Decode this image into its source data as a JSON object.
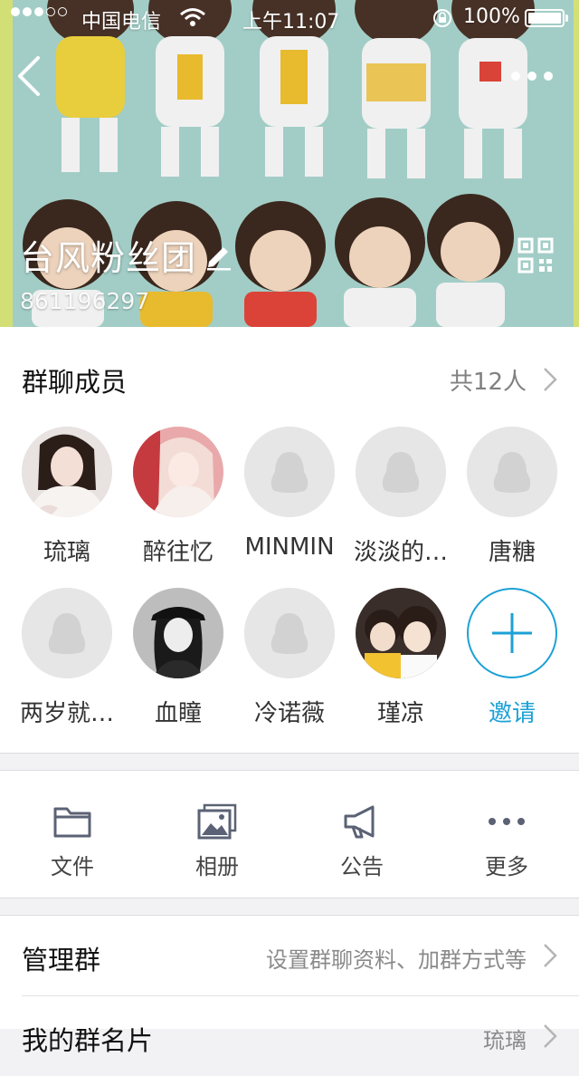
{
  "status_bar": {
    "carrier": "中国电信",
    "time": "上午11:07",
    "battery": "100%"
  },
  "group": {
    "name": "台风粉丝团",
    "id": "861196297"
  },
  "members": {
    "title": "群聊成员",
    "count": "共12人",
    "list": [
      {
        "name": "琉璃",
        "avatar": "photo-girl-white"
      },
      {
        "name": "醉往忆",
        "avatar": "photo-girl-pink"
      },
      {
        "name": "MINMIN",
        "avatar": "default-penguin"
      },
      {
        "name": "淡淡的…",
        "avatar": "default-penguin"
      },
      {
        "name": "唐糖",
        "avatar": "default-penguin"
      },
      {
        "name": "两岁就…",
        "avatar": "default-penguin"
      },
      {
        "name": "血瞳",
        "avatar": "photo-girl-cap"
      },
      {
        "name": "冷诺薇",
        "avatar": "default-penguin"
      },
      {
        "name": "瑾凉",
        "avatar": "photo-two-boys"
      }
    ],
    "invite_label": "邀请"
  },
  "tools": [
    {
      "label": "文件",
      "icon": "folder-icon"
    },
    {
      "label": "相册",
      "icon": "album-icon"
    },
    {
      "label": "公告",
      "icon": "megaphone-icon"
    },
    {
      "label": "更多",
      "icon": "more-dots-icon"
    }
  ],
  "settings": [
    {
      "label": "管理群",
      "value": "设置群聊资料、加群方式等"
    },
    {
      "label": "我的群名片",
      "value": "琉璃"
    }
  ],
  "colors": {
    "accent": "#1da1d6",
    "header_bg": "#d7e86c",
    "poster_bg": "#a9d6cf"
  }
}
